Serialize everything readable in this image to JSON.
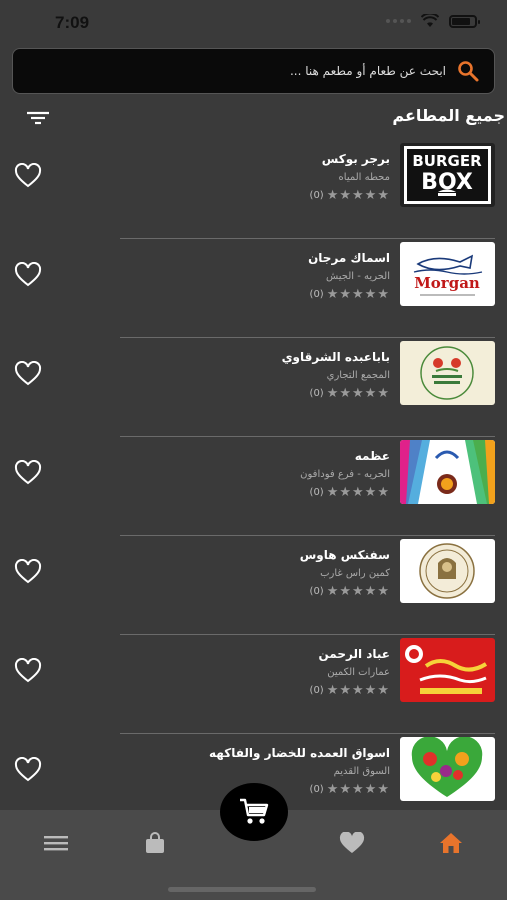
{
  "status_bar": {
    "time": "7:09"
  },
  "search": {
    "placeholder": "ابحث عن طعام أو مطعم هنا ..."
  },
  "section_title": "جميع المطاعم",
  "restaurants": [
    {
      "name": "برجر بوكس",
      "address": "محطه المياه",
      "rating_count": "(0)",
      "stars": "★★★★★",
      "thumb": "burger-box-logo"
    },
    {
      "name": "اسماك مرجان",
      "address": "الحريه - الجيش",
      "rating_count": "(0)",
      "stars": "★★★★★",
      "thumb": "morgan-logo",
      "logo_text": "Morgan"
    },
    {
      "name": "باباعبده الشرقاوي",
      "address": "المجمع التجاري",
      "rating_count": "(0)",
      "stars": "★★★★★",
      "thumb": "baba-abdo-logo"
    },
    {
      "name": "عظمه",
      "address": "الحريه - فرع فودافون",
      "rating_count": "(0)",
      "stars": "★★★★★",
      "thumb": "azama-logo"
    },
    {
      "name": "سفنكس هاوس",
      "address": "كمين راس غارب",
      "rating_count": "(0)",
      "stars": "★★★★★",
      "thumb": "sphinx-house-logo"
    },
    {
      "name": "عباد الرحمن",
      "address": "عمارات الكمين",
      "rating_count": "(0)",
      "stars": "★★★★★",
      "thumb": "ebad-alrahman-logo"
    },
    {
      "name": "اسواق العمده للخضار والفاكهه",
      "address": "السوق القديم",
      "rating_count": "(0)",
      "stars": "★★★★★",
      "thumb": "vegetables-heart-image"
    }
  ],
  "nav": {
    "items": [
      "menu-icon",
      "bag-icon",
      "heart-icon",
      "home-icon"
    ],
    "active": "home-icon",
    "accent": "#e8742c"
  },
  "colors": {
    "background": "#3a3a3a",
    "search_icon": "#e8742c"
  }
}
